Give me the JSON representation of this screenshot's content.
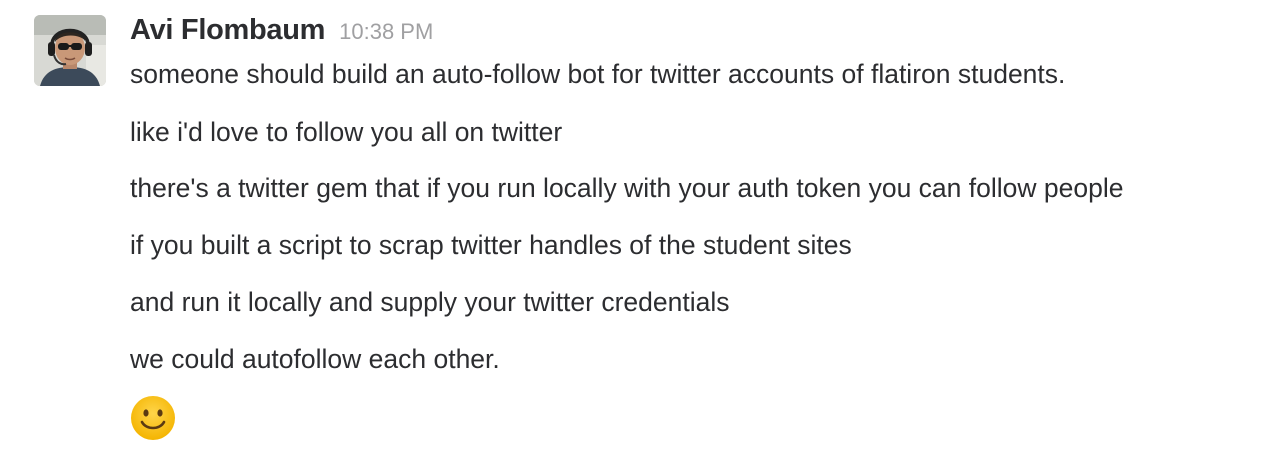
{
  "message": {
    "sender": "Avi Flombaum",
    "time": "10:38 PM",
    "lines": [
      "someone should build an auto-follow bot for twitter accounts of flatiron students.",
      "like i'd love to follow you all on twitter",
      "there's a twitter gem that if you run locally with your auth token you can follow people",
      "if you built a script to scrap twitter handles of the student sites",
      "and run it locally and supply your twitter credentials",
      "we could autofollow each other."
    ],
    "emoji": "slightly-smiling-face",
    "avatar_icon": "user-avatar"
  }
}
